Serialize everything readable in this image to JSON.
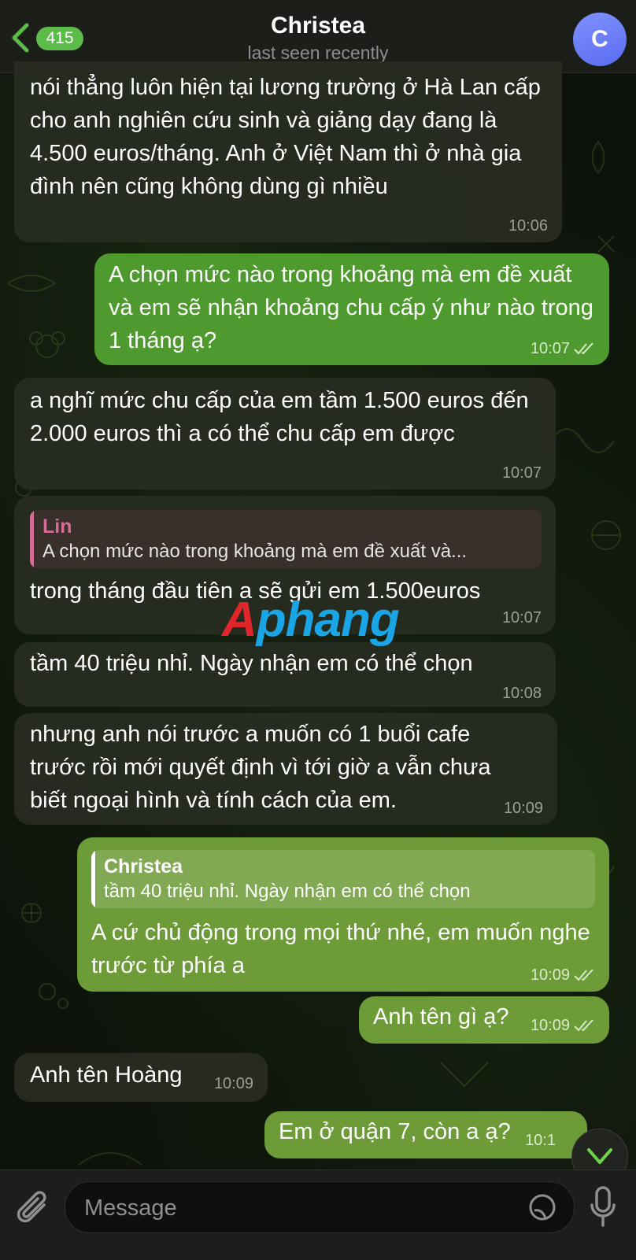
{
  "header": {
    "back_count": "415",
    "title": "Christea",
    "subtitle": "last seen recently",
    "avatar_letter": "C"
  },
  "messages": [
    {
      "text": "nói thẳng luôn hiện tại lương trường ở Hà Lan cấp cho anh nghiên cứu sinh và giảng dạy đang là 4.500 euros/tháng. Anh ở Việt Nam thì ở nhà gia đình nên cũng không dùng gì nhiều",
      "time": "10:06"
    },
    {
      "text": "A chọn mức nào trong khoảng mà em đề xuất và em sẽ nhận khoảng chu cấp ý như nào trong 1 tháng ạ?",
      "time": "10:07"
    },
    {
      "text": "a nghĩ mức chu cấp của em tầm 1.500 euros đến 2.000 euros thì a có thể chu cấp em được",
      "time": "10:07"
    },
    {
      "reply_name": "Lin",
      "reply_text": "A chọn mức nào trong khoảng mà em đề xuất và...",
      "text": "trong tháng đầu tiên a sẽ gửi em 1.500euros",
      "time": "10:07"
    },
    {
      "text": "tầm 40 triệu nhỉ. Ngày nhận em có thể chọn",
      "time": "10:08"
    },
    {
      "text": "nhưng anh nói trước a muốn có 1 buổi cafe trước rồi mới quyết định vì tới giờ a vẫn chưa biết ngoại hình và tính cách của em.",
      "time": "10:09"
    },
    {
      "reply_name": "Christea",
      "reply_text": "tầm 40 triệu nhỉ. Ngày nhận em có thể chọn",
      "text": "A cứ chủ động trong mọi thứ nhé, em muốn nghe trước từ phía a",
      "time": "10:09"
    },
    {
      "text": "Anh tên gì ạ?",
      "time": "10:09"
    },
    {
      "text": "Anh tên Hoàng",
      "time": "10:09"
    },
    {
      "text": "Em ở quận 7, còn a ạ?",
      "time": "10:1"
    }
  ],
  "watermark": "Aphang",
  "composer": {
    "placeholder": "Message"
  },
  "colors": {
    "accent": "#5dbb4a",
    "outgoing": "#4e9a2e",
    "incoming": "#282c22",
    "avatar": "#6f80f8"
  }
}
